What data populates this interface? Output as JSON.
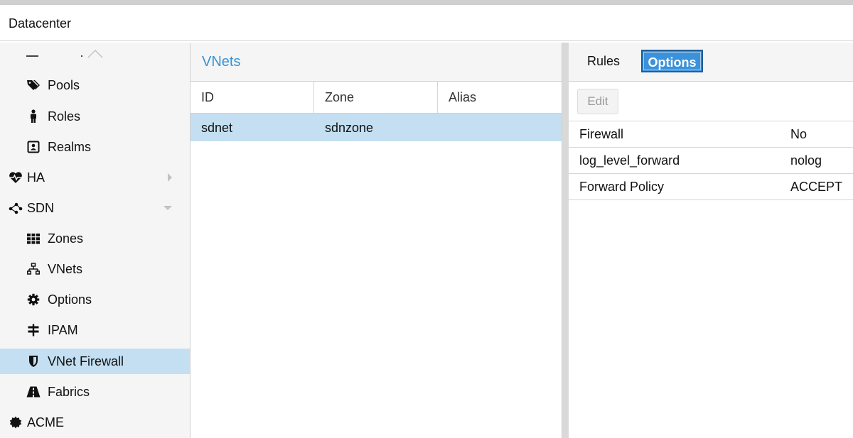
{
  "window": {
    "title": "Datacenter"
  },
  "sidebar": {
    "items": [
      {
        "label": "Pools",
        "icon": "tags-icon"
      },
      {
        "label": "Roles",
        "icon": "male-icon"
      },
      {
        "label": "Realms",
        "icon": "address-book-icon"
      },
      {
        "label": "HA",
        "icon": "heartbeat-icon"
      },
      {
        "label": "SDN",
        "icon": "sdn-icon"
      },
      {
        "label": "Zones",
        "icon": "th-icon"
      },
      {
        "label": "VNets",
        "icon": "network-icon"
      },
      {
        "label": "Options",
        "icon": "gear-icon"
      },
      {
        "label": "IPAM",
        "icon": "signpost-icon"
      },
      {
        "label": "VNet Firewall",
        "icon": "shield-icon"
      },
      {
        "label": "Fabrics",
        "icon": "road-icon"
      },
      {
        "label": "ACME",
        "icon": "certificate-icon"
      }
    ],
    "selected": "VNet Firewall"
  },
  "vnets": {
    "title": "VNets",
    "columns": [
      "ID",
      "Zone",
      "Alias"
    ],
    "rows": [
      {
        "id": "sdnet",
        "zone": "sdnzone",
        "alias": ""
      }
    ]
  },
  "right": {
    "tabs": [
      {
        "label": "Rules",
        "active": false
      },
      {
        "label": "Options",
        "active": true
      }
    ],
    "edit_label": "Edit",
    "options": [
      {
        "key": "Firewall",
        "value": "No"
      },
      {
        "key": "log_level_forward",
        "value": "nolog"
      },
      {
        "key": "Forward Policy",
        "value": "ACCEPT"
      }
    ]
  },
  "colors": {
    "accent": "#3892d4",
    "selection": "#c4dff2",
    "active_tab": "#3b92da"
  }
}
